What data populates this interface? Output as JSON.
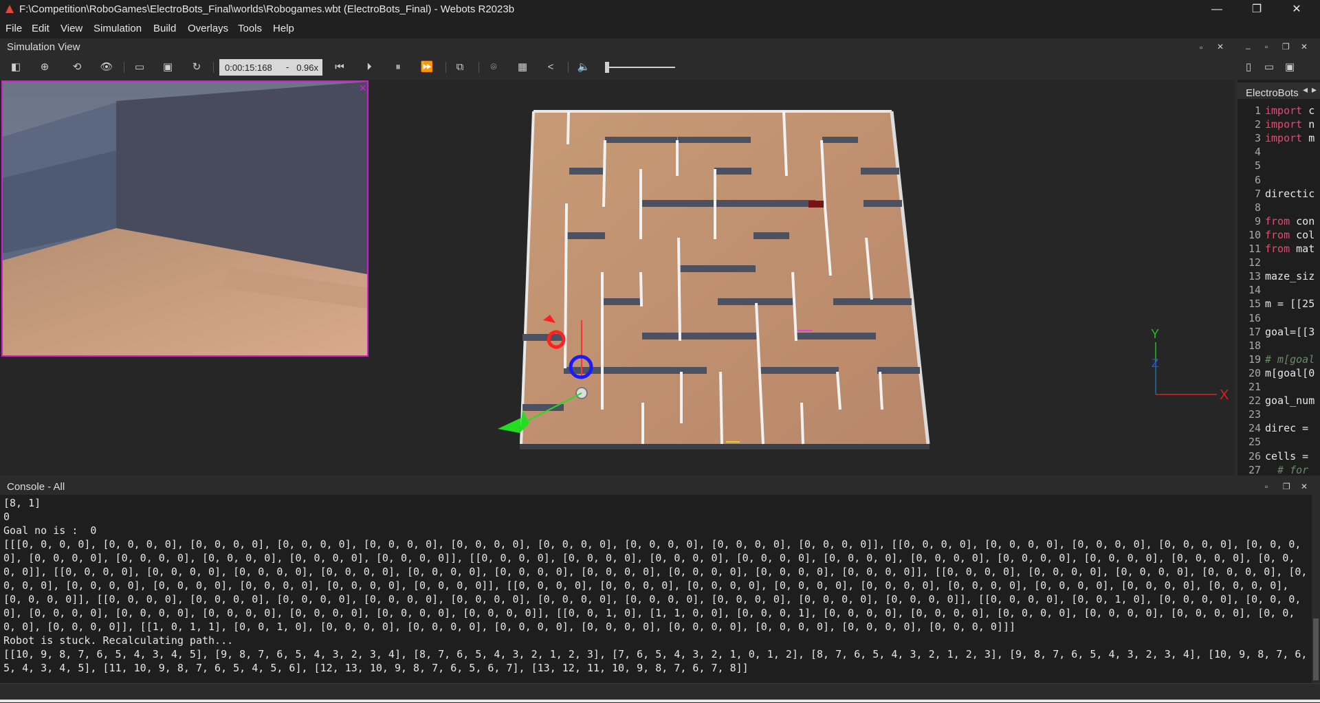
{
  "window": {
    "title": "F:\\Competition\\RoboGames\\ElectroBots_Final\\worlds\\Robogames.wbt (ElectroBots_Final) - Webots R2023b",
    "minimize": "—",
    "restore": "❐",
    "close": "✕"
  },
  "menu": [
    "File",
    "Edit",
    "View",
    "Simulation",
    "Build",
    "Overlays",
    "Tools",
    "Help"
  ],
  "simulation_view": {
    "title": "Simulation View",
    "time": "0:00:15:168",
    "dash": "-",
    "speed": "0.96x"
  },
  "editor": {
    "tab_label": "ElectroBots",
    "lines": [
      {
        "n": "1",
        "kw": "import",
        "rest": " c"
      },
      {
        "n": "2",
        "kw": "import",
        "rest": " n"
      },
      {
        "n": "3",
        "kw": "import",
        "rest": " m"
      },
      {
        "n": "4",
        "kw": "",
        "rest": ""
      },
      {
        "n": "5",
        "kw": "",
        "rest": ""
      },
      {
        "n": "6",
        "kw": "",
        "rest": ""
      },
      {
        "n": "7",
        "kw": "",
        "rest": "directic"
      },
      {
        "n": "8",
        "kw": "",
        "rest": ""
      },
      {
        "n": "9",
        "kw": "from",
        "rest": " con"
      },
      {
        "n": "10",
        "kw": "from",
        "rest": " col"
      },
      {
        "n": "11",
        "kw": "from",
        "rest": " mat"
      },
      {
        "n": "12",
        "kw": "",
        "rest": ""
      },
      {
        "n": "13",
        "kw": "",
        "rest": "maze_siz"
      },
      {
        "n": "14",
        "kw": "",
        "rest": ""
      },
      {
        "n": "15",
        "kw": "",
        "rest": "m = [[25"
      },
      {
        "n": "16",
        "kw": "",
        "rest": ""
      },
      {
        "n": "17",
        "kw": "",
        "rest": "goal=[[3"
      },
      {
        "n": "18",
        "kw": "",
        "rest": ""
      },
      {
        "n": "19",
        "kw": "",
        "rest": "# m[goal",
        "comment": true
      },
      {
        "n": "20",
        "kw": "",
        "rest": "m[goal[0"
      },
      {
        "n": "21",
        "kw": "",
        "rest": ""
      },
      {
        "n": "22",
        "kw": "",
        "rest": "goal_num"
      },
      {
        "n": "23",
        "kw": "",
        "rest": ""
      },
      {
        "n": "24",
        "kw": "",
        "rest": "direc ="
      },
      {
        "n": "25",
        "kw": "",
        "rest": ""
      },
      {
        "n": "26",
        "kw": "",
        "rest": "cells ="
      },
      {
        "n": "27",
        "kw": "",
        "rest": "  # for",
        "comment": true
      }
    ]
  },
  "axes": {
    "x": "X",
    "y": "Y",
    "z": "Z"
  },
  "console": {
    "title": "Console - All",
    "lines": [
      "[8, 1]",
      "0",
      "Goal no is :  0",
      "[[[0, 0, 0, 0], [0, 0, 0, 0], [0, 0, 0, 0], [0, 0, 0, 0], [0, 0, 0, 0], [0, 0, 0, 0], [0, 0, 0, 0], [0, 0, 0, 0], [0, 0, 0, 0], [0, 0, 0, 0]], [[0, 0, 0, 0], [0, 0, 0, 0], [0, 0, 0, 0], [0, 0, 0, 0], [0, 0, 0, 0], [0, 0, 0, 0], [0, 0, 0, 0], [0, 0, 0, 0], [0, 0, 0, 0], [0, 0, 0, 0]], [[0, 0, 0, 0], [0, 0, 0, 0], [0, 0, 0, 0], [0, 0, 0, 0], [0, 0, 0, 0], [0, 0, 0, 0], [0, 0, 0, 0], [0, 0, 0, 0], [0, 0, 0, 0], [0, 0, 0, 0]], [[0, 0, 0, 0], [0, 0, 0, 0], [0, 0, 0, 0], [0, 0, 0, 0], [0, 0, 0, 0], [0, 0, 0, 0], [0, 0, 0, 0], [0, 0, 0, 0], [0, 0, 0, 0], [0, 0, 0, 0]], [[0, 0, 0, 0], [0, 0, 0, 0], [0, 0, 0, 0], [0, 0, 0, 0], [0, 0, 0, 0], [0, 0, 0, 0], [0, 0, 0, 0], [0, 0, 0, 0], [0, 0, 0, 0], [0, 0, 0, 0]], [[0, 0, 0, 0], [0, 0, 0, 0], [0, 0, 0, 0], [0, 0, 0, 0], [0, 0, 0, 0], [0, 0, 0, 0], [0, 0, 0, 0], [0, 0, 0, 0], [0, 0, 0, 0], [0, 0, 0, 0]], [[0, 0, 0, 0], [0, 0, 0, 0], [0, 0, 0, 0], [0, 0, 0, 0], [0, 0, 0, 0], [0, 0, 0, 0], [0, 0, 0, 0], [0, 0, 0, 0], [0, 0, 0, 0], [0, 0, 0, 0]], [[0, 0, 0, 0], [0, 0, 1, 0], [0, 0, 0, 0], [0, 0, 0, 0], [0, 0, 0, 0], [0, 0, 0, 0], [0, 0, 0, 0], [0, 0, 0, 0], [0, 0, 0, 0], [0, 0, 0, 0]], [[0, 0, 1, 0], [1, 1, 0, 0], [0, 0, 0, 1], [0, 0, 0, 0], [0, 0, 0, 0], [0, 0, 0, 0], [0, 0, 0, 0], [0, 0, 0, 0], [0, 0, 0, 0], [0, 0, 0, 0]], [[1, 0, 1, 1], [0, 0, 1, 0], [0, 0, 0, 0], [0, 0, 0, 0], [0, 0, 0, 0], [0, 0, 0, 0], [0, 0, 0, 0], [0, 0, 0, 0], [0, 0, 0, 0], [0, 0, 0, 0]]]",
      "Robot is stuck. Recalculating path...",
      "[[10, 9, 8, 7, 6, 5, 4, 3, 4, 5], [9, 8, 7, 6, 5, 4, 3, 2, 3, 4], [8, 7, 6, 5, 4, 3, 2, 1, 2, 3], [7, 6, 5, 4, 3, 2, 1, 0, 1, 2], [8, 7, 6, 5, 4, 3, 2, 1, 2, 3], [9, 8, 7, 6, 5, 4, 3, 2, 3, 4], [10, 9, 8, 7, 6, 5, 4, 3, 4, 5], [11, 10, 9, 8, 7, 6, 5, 4, 5, 6], [12, 13, 10, 9, 8, 7, 6, 5, 6, 7], [13, 12, 11, 10, 9, 8, 7, 6, 7, 8]]"
    ]
  }
}
